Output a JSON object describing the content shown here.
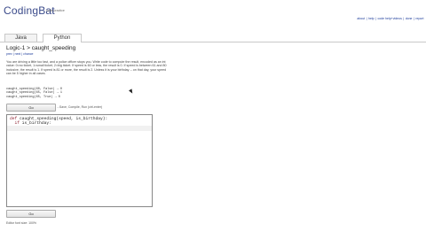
{
  "header": {
    "logo": "CodingBat",
    "tagline": "code practice",
    "links": [
      "about",
      "help",
      "code help+videos",
      "done",
      "report"
    ]
  },
  "tabs": [
    {
      "label": "Java"
    },
    {
      "label": "Python"
    }
  ],
  "problem": {
    "title": "Logic-1 > caught_speeding",
    "breadcrumbs": "prev  |  next  |  chance",
    "description": "You are driving a little too fast, and a police officer stops you. Write code to compute the result, encoded as an int value: 0=no ticket, 1=small ticket, 2=big ticket. If speed is 60 or less, the result is 0. If speed is between 61 and 80 inclusive, the result is 1. If speed is 81 or more, the result is 2. Unless it is your birthday -- on that day, your speed can be 5 higher in all cases.",
    "examples": [
      "caught_speeding(60, False) → 0",
      "caught_speeding(65, False) → 1",
      "caught_speeding(65, True) → 0"
    ]
  },
  "controls": {
    "go_label": "Go",
    "go_note": "...Save, Compile, Run (ctrl-enter)",
    "bottom_note": "Editor font size: 100%"
  },
  "editor": {
    "line1_keyword": "def",
    "line1_rest": " caught_speeding(speed, is_birthday):",
    "line2_keyword": "  if",
    "line2_rest": " is_birthday:"
  }
}
